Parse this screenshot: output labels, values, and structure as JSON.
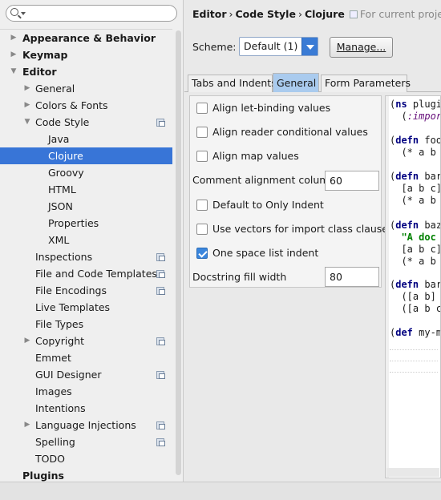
{
  "search": {
    "placeholder": "",
    "value": ""
  },
  "tree": {
    "items": [
      {
        "label": "Appearance & Behavior",
        "level": 0,
        "bold": true,
        "arrow": "collapsed",
        "project_icon": false,
        "selected": false
      },
      {
        "label": "Keymap",
        "level": 0,
        "bold": true,
        "arrow": "collapsed",
        "project_icon": false,
        "selected": false
      },
      {
        "label": "Editor",
        "level": 0,
        "bold": true,
        "arrow": "expanded",
        "project_icon": false,
        "selected": false
      },
      {
        "label": "General",
        "level": 1,
        "bold": false,
        "arrow": "collapsed",
        "project_icon": false,
        "selected": false
      },
      {
        "label": "Colors & Fonts",
        "level": 1,
        "bold": false,
        "arrow": "collapsed",
        "project_icon": false,
        "selected": false
      },
      {
        "label": "Code Style",
        "level": 1,
        "bold": false,
        "arrow": "expanded",
        "project_icon": true,
        "selected": false
      },
      {
        "label": "Java",
        "level": 2,
        "bold": false,
        "arrow": "none",
        "project_icon": false,
        "selected": false
      },
      {
        "label": "Clojure",
        "level": 2,
        "bold": false,
        "arrow": "none",
        "project_icon": false,
        "selected": true
      },
      {
        "label": "Groovy",
        "level": 2,
        "bold": false,
        "arrow": "none",
        "project_icon": false,
        "selected": false
      },
      {
        "label": "HTML",
        "level": 2,
        "bold": false,
        "arrow": "none",
        "project_icon": false,
        "selected": false
      },
      {
        "label": "JSON",
        "level": 2,
        "bold": false,
        "arrow": "none",
        "project_icon": false,
        "selected": false
      },
      {
        "label": "Properties",
        "level": 2,
        "bold": false,
        "arrow": "none",
        "project_icon": false,
        "selected": false
      },
      {
        "label": "XML",
        "level": 2,
        "bold": false,
        "arrow": "none",
        "project_icon": false,
        "selected": false
      },
      {
        "label": "Inspections",
        "level": 1,
        "bold": false,
        "arrow": "none",
        "project_icon": true,
        "selected": false
      },
      {
        "label": "File and Code Templates",
        "level": 1,
        "bold": false,
        "arrow": "none",
        "project_icon": true,
        "selected": false
      },
      {
        "label": "File Encodings",
        "level": 1,
        "bold": false,
        "arrow": "none",
        "project_icon": true,
        "selected": false
      },
      {
        "label": "Live Templates",
        "level": 1,
        "bold": false,
        "arrow": "none",
        "project_icon": false,
        "selected": false
      },
      {
        "label": "File Types",
        "level": 1,
        "bold": false,
        "arrow": "none",
        "project_icon": false,
        "selected": false
      },
      {
        "label": "Copyright",
        "level": 1,
        "bold": false,
        "arrow": "collapsed",
        "project_icon": true,
        "selected": false
      },
      {
        "label": "Emmet",
        "level": 1,
        "bold": false,
        "arrow": "none",
        "project_icon": false,
        "selected": false
      },
      {
        "label": "GUI Designer",
        "level": 1,
        "bold": false,
        "arrow": "none",
        "project_icon": true,
        "selected": false
      },
      {
        "label": "Images",
        "level": 1,
        "bold": false,
        "arrow": "none",
        "project_icon": false,
        "selected": false
      },
      {
        "label": "Intentions",
        "level": 1,
        "bold": false,
        "arrow": "none",
        "project_icon": false,
        "selected": false
      },
      {
        "label": "Language Injections",
        "level": 1,
        "bold": false,
        "arrow": "collapsed",
        "project_icon": true,
        "selected": false
      },
      {
        "label": "Spelling",
        "level": 1,
        "bold": false,
        "arrow": "none",
        "project_icon": true,
        "selected": false
      },
      {
        "label": "TODO",
        "level": 1,
        "bold": false,
        "arrow": "none",
        "project_icon": false,
        "selected": false
      },
      {
        "label": "Plugins",
        "level": 0,
        "bold": true,
        "arrow": "none",
        "project_icon": false,
        "selected": false
      }
    ]
  },
  "breadcrumb": {
    "part1": "Editor",
    "part2": "Code Style",
    "part3": "Clojure",
    "sep": "›",
    "project_note": "For current project"
  },
  "scheme": {
    "label": "Scheme:",
    "value": "Default (1)",
    "manage_label": "Manage..."
  },
  "tabs": [
    {
      "label": "Tabs and Indents",
      "active": false
    },
    {
      "label": "General",
      "active": true
    },
    {
      "label": "Form Parameters",
      "active": false
    }
  ],
  "options": {
    "align_let": {
      "label": "Align let-binding values",
      "checked": false
    },
    "align_reader": {
      "label": "Align reader conditional values",
      "checked": false
    },
    "align_map": {
      "label": "Align map values",
      "checked": false
    },
    "comment_col": {
      "label": "Comment alignment column",
      "value": "60"
    },
    "default_indent": {
      "label": "Default to Only Indent",
      "checked": false
    },
    "vectors_import": {
      "label": "Use vectors for import class clauses",
      "checked": false
    },
    "one_space": {
      "label": "One space list indent",
      "checked": true
    },
    "docstring": {
      "label": "Docstring fill width",
      "value": "80"
    }
  },
  "preview": {
    "lines": [
      "(ns plugin",
      "  (:import",
      "(defn foo",
      "  (* a b c",
      "(defn bar",
      "  [a b c]",
      "  (* a b c",
      "(defn baz",
      "  \"A doc s",
      "  [a b c]",
      "  (* a b c",
      "(defn bar",
      "  ([a b] (",
      "  ([a b c]",
      "(def my-ma"
    ]
  }
}
